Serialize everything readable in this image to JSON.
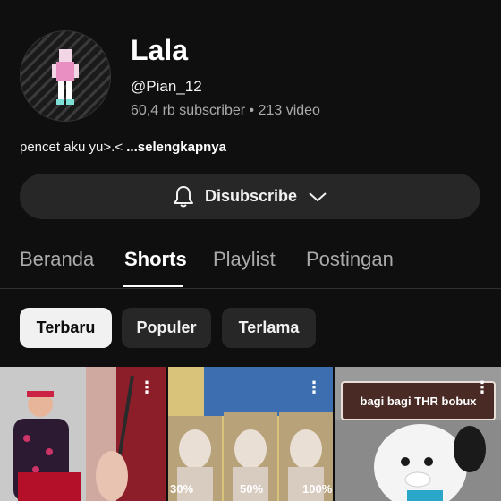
{
  "channel": {
    "name": "Lala",
    "handle": "@Pian_12",
    "stats": "60,4 rb subscriber • 213 video",
    "description": "pencet aku yu>.<",
    "more_label": "...selengkapnya"
  },
  "subscribe": {
    "label": "Disubscribe",
    "bell_icon": "bell-icon",
    "chevron_icon": "chevron-down-icon"
  },
  "tabs": [
    {
      "label": "Beranda",
      "active": false
    },
    {
      "label": "Shorts",
      "active": true
    },
    {
      "label": "Playlist",
      "active": false
    },
    {
      "label": "Postingan",
      "active": false
    }
  ],
  "filters": [
    {
      "label": "Terbaru",
      "active": true
    },
    {
      "label": "Populer",
      "active": false
    },
    {
      "label": "Terlama",
      "active": false
    }
  ],
  "shorts": [
    {
      "menu_icon": "more-vertical-icon"
    },
    {
      "menu_icon": "more-vertical-icon",
      "overlay_labels": [
        "30%",
        "50%",
        "100%"
      ]
    },
    {
      "menu_icon": "more-vertical-icon",
      "overlay_text": "bagi bagi THR bobux"
    }
  ],
  "colors": {
    "background": "#0f0f0f",
    "surface": "#272727",
    "text_primary": "#f1f1f1",
    "text_secondary": "#aaaaaa"
  }
}
